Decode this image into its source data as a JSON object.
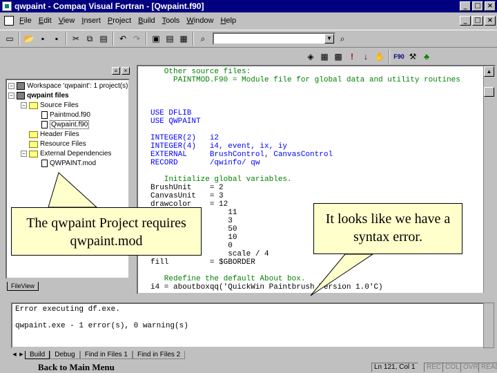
{
  "window": {
    "title": "qwpaint - Compaq Visual Fortran - [Qwpaint.f90]",
    "controls": [
      "_",
      "□",
      "×"
    ]
  },
  "menu": [
    "File",
    "Edit",
    "View",
    "Insert",
    "Project",
    "Build",
    "Tools",
    "Window",
    "Help"
  ],
  "workspace": {
    "tree": [
      "Workspace 'qwpaint': 1 project(s)",
      "qwpaint files",
      "Source Files",
      "Paintmod.f90",
      "Qwpaint.f90",
      "Header Files",
      "Resource Files",
      "External Dependencies",
      "QWPAINT.mod"
    ],
    "tab": "FileView"
  },
  "editor": {
    "lines": [
      {
        "text": "   Other source files:",
        "type": "cm"
      },
      {
        "text": "     PAINTMOD.F90 = Module file for global data and utility routines",
        "type": "cm"
      },
      {
        "text": "",
        "type": ""
      },
      {
        "text": "",
        "type": ""
      },
      {
        "text": "",
        "type": ""
      },
      {
        "text": "USE DFLIB",
        "type": "kw"
      },
      {
        "text": "USE QWPAINT",
        "type": "kw"
      },
      {
        "text": "",
        "type": ""
      },
      {
        "text": "INTEGER(2)   i2",
        "type": "kw"
      },
      {
        "text": "INTEGER(4)   i4, event, ix, iy",
        "type": "kw"
      },
      {
        "text": "EXTERNAL     BrushControl, CanvasControl",
        "type": "kw"
      },
      {
        "text": "RECORD       /qwinfo/ qw",
        "type": "kw"
      },
      {
        "text": "",
        "type": ""
      },
      {
        "text": "   Initialize global variables.",
        "type": "cm"
      },
      {
        "text": "BrushUnit    = 2",
        "type": ""
      },
      {
        "text": "CanvasUnit   = 3",
        "type": ""
      },
      {
        "text": "drawcolor    = 12",
        "type": ""
      },
      {
        "text": "                 11",
        "type": ""
      },
      {
        "text": "                 3",
        "type": ""
      },
      {
        "text": "                 50",
        "type": ""
      },
      {
        "text": "                 10",
        "type": ""
      },
      {
        "text": "                 0",
        "type": ""
      },
      {
        "text": "                 scale / 4",
        "type": ""
      },
      {
        "text": "fill         = $GBORDER",
        "type": ""
      },
      {
        "text": "",
        "type": ""
      },
      {
        "text": "   Redefine the default About box.",
        "type": "cm"
      },
      {
        "text": "i4 = aboutboxqq('QuickWin Paintbrush Version 1.0'C)",
        "type": ""
      }
    ]
  },
  "output": {
    "lines": [
      "Error executing df.exe.",
      "",
      "qwpaint.exe - 1 error(s), 0 warning(s)"
    ],
    "tabs": [
      "Build",
      "Debug",
      "Find in Files 1",
      "Find in Files 2"
    ]
  },
  "status": {
    "back": "Back to Main Menu",
    "position": "Ln 121, Col 1",
    "indicators": [
      "REC",
      "COL",
      "OVR",
      "READ"
    ]
  },
  "callouts": {
    "left": "The qwpaint Project requires qwpaint.mod",
    "right": "It looks like we have a syntax error."
  },
  "colors": {
    "titlebar": "#000080",
    "comment": "#008000",
    "keyword": "#0000ff",
    "callout_fill": "#ffffcc"
  }
}
